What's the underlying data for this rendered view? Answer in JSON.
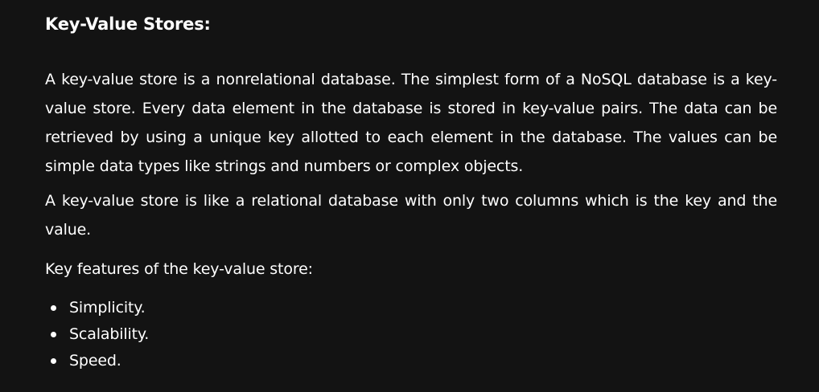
{
  "article": {
    "heading": "Key-Value Stores:",
    "paragraphs": [
      "A key-value store is a nonrelational database. The simplest form of a NoSQL database is a key-value store. Every data element in the database is stored in key-value pairs. The data can be retrieved by using a unique key allotted to each element in the database. The values can be simple data types like strings and numbers or complex objects.",
      "A key-value store is like a relational database with only two columns which is the key and the value.",
      "Key features of the key-value store:"
    ],
    "features": [
      "Simplicity.",
      "Scalability.",
      "Speed."
    ]
  }
}
